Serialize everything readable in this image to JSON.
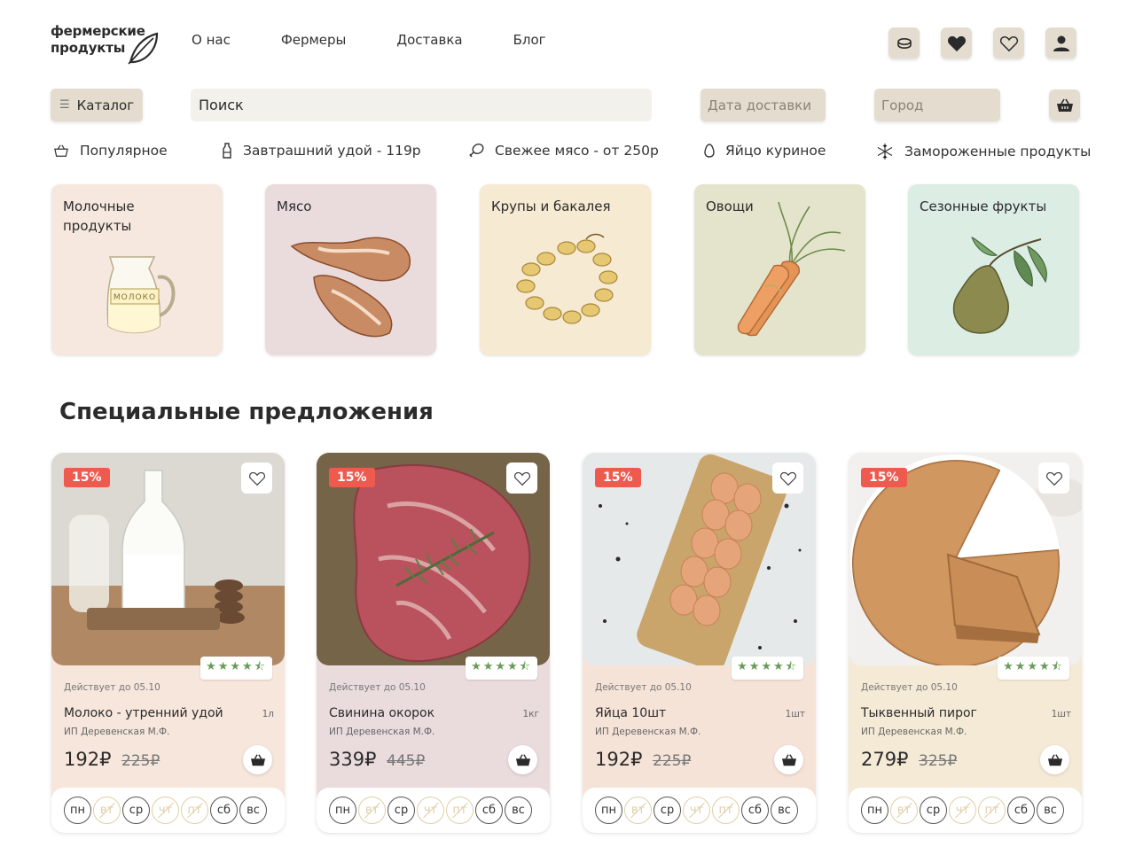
{
  "header": {
    "logo_line1": "фермерские",
    "logo_line2": "продукты",
    "nav": [
      "О нас",
      "Фермеры",
      "Доставка",
      "Блог"
    ],
    "icons": [
      "coins-icon",
      "heart-filled-icon",
      "heart-outline-icon",
      "user-icon"
    ]
  },
  "toolbar": {
    "catalog_label": "Каталог",
    "search_placeholder": "Поиск",
    "date_placeholder": "Дата доставки",
    "city_placeholder": "Город"
  },
  "quick_links": [
    {
      "label": "Популярное",
      "icon": "basket-icon"
    },
    {
      "label": "Завтрашний удой - 119р",
      "icon": "milk-bottle-icon"
    },
    {
      "label": "Свежее мясо - от 250р",
      "icon": "meat-icon"
    },
    {
      "label": "Яйцо куриное",
      "icon": "egg-icon"
    },
    {
      "label": "Замороженные продукты",
      "icon": "snowflake-icon"
    }
  ],
  "categories": [
    {
      "title": "Молочные\n продукты",
      "bg": "#f6e8df",
      "image_label": "МОЛОКО"
    },
    {
      "title": "Мясо",
      "bg": "#eadcdc"
    },
    {
      "title": "Крупы и бакалея",
      "bg": "#f7ead2"
    },
    {
      "title": "Овощи",
      "bg": "#e4e4cd"
    },
    {
      "title": "Сезонные фрукты",
      "bg": "#dcede4"
    }
  ],
  "section_title": "Специальные предложения",
  "products": [
    {
      "discount": "15%",
      "rating": "★★★★⯪",
      "valid": "Действует до 05.10",
      "name": "Молоко - утренний удой",
      "unit": "1л",
      "seller": "ИП Деревенская М.Ф.",
      "price": "192₽",
      "old_price": "225₽",
      "bg": "#f6e6dc"
    },
    {
      "discount": "15%",
      "rating": "★★★★⯪",
      "valid": "Действует до 05.10",
      "name": "Свинина окорок",
      "unit": "1кг",
      "seller": "ИП Деревенская М.Ф.",
      "price": "339₽",
      "old_price": "445₽",
      "bg": "#eadcdc"
    },
    {
      "discount": "15%",
      "rating": "★★★★⯪",
      "valid": "Действует до 05.10",
      "name": "Яйца 10шт",
      "unit": "1шт",
      "seller": "ИП Деревенская М.Ф.",
      "price": "192₽",
      "old_price": "225₽",
      "bg": "#f6e3d8"
    },
    {
      "discount": "15%",
      "rating": "★★★★⯪",
      "valid": "Действует до 05.10",
      "name": "Тыквенный пирог",
      "unit": "1шт",
      "seller": "ИП Деревенская М.Ф.",
      "price": "279₽",
      "old_price": "325₽",
      "bg": "#f5ead6"
    }
  ],
  "days": [
    {
      "label": "пн",
      "available": true
    },
    {
      "label": "вт",
      "available": false
    },
    {
      "label": "ср",
      "available": true
    },
    {
      "label": "чт",
      "available": false
    },
    {
      "label": "пт",
      "available": false
    },
    {
      "label": "сб",
      "available": true
    },
    {
      "label": "вс",
      "available": true
    }
  ]
}
